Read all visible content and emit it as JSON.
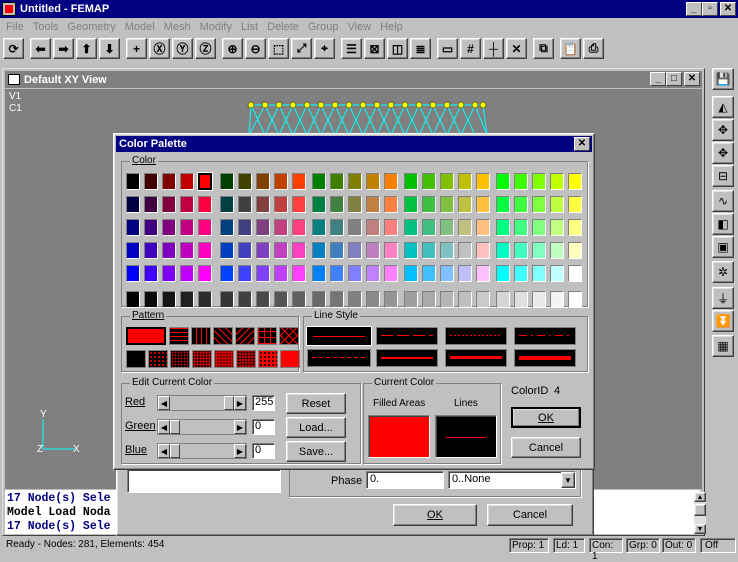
{
  "app": {
    "title": "Untitled - FEMAP"
  },
  "menu": [
    "File",
    "Tools",
    "Geometry",
    "Model",
    "Mesh",
    "Modify",
    "List",
    "Delete",
    "Group",
    "View",
    "Help"
  ],
  "toolbar_icons": [
    "rotate-icon",
    "prev-icon",
    "next-icon",
    "up-icon",
    "down-icon",
    "add-icon",
    "rotate-x-icon",
    "rotate-y-icon",
    "rotate-z-icon",
    "zoom-in-icon",
    "zoom-out-icon",
    "box-zoom-icon",
    "fit-icon",
    "center-icon",
    "list-icon",
    "select-icon",
    "solid-icon",
    "layers-icon",
    "window-icon",
    "grid-icon",
    "plus-icon",
    "cross-icon",
    "copy-icon",
    "paste-icon",
    "print-icon"
  ],
  "view_window": {
    "title": "Default XY View",
    "label_v": "V1",
    "label_c": "C1",
    "axis_y": "Y",
    "axis_z": "Z",
    "axis_x": "X"
  },
  "messages": [
    "17 Node(s) Sele",
    "Model Load Noda",
    "17 Node(s) Sele"
  ],
  "status": {
    "text": "Ready - Nodes: 281,  Elements: 454",
    "cells": [
      "Prop: 1",
      "Ld: 1",
      "Con: 1",
      "Grp: 0",
      "Out: 0",
      "Off"
    ]
  },
  "dialog": {
    "title": "Color Palette",
    "color_group": "Color",
    "pattern_group": "Pattern",
    "line_style_group": "Line Style",
    "edit_group": "Edit Current Color",
    "current_group": "Current Color",
    "red_label": "Red",
    "green_label": "Green",
    "blue_label": "Blue",
    "red_value": "255",
    "green_value": "0",
    "blue_value": "0",
    "reset_button": "Reset",
    "load_button": "Load...",
    "save_button": "Save...",
    "filled_areas": "Filled Areas",
    "lines": "Lines",
    "color_id_label": "ColorID",
    "color_id": "4",
    "ok_button": "OK",
    "cancel_button": "Cancel",
    "current_color": "#ff0000"
  },
  "back_dialog": {
    "phase_label": "Phase",
    "phase_value": "0.",
    "select_value": "0..None",
    "ok_button": "OK",
    "cancel_button": "Cancel"
  },
  "palette": {
    "row_count": 6,
    "blocks": [
      {
        "bases": [
          "#000000",
          "#400000",
          "#800000",
          "#c00000",
          "#ff0000"
        ]
      },
      {
        "bases": [
          "#004000",
          "#404000",
          "#804000",
          "#c04000",
          "#ff4000"
        ]
      },
      {
        "bases": [
          "#008000",
          "#408000",
          "#808000",
          "#c08000",
          "#ff8000"
        ]
      },
      {
        "bases": [
          "#00c000",
          "#40c000",
          "#80c000",
          "#c0c000",
          "#ffc000"
        ]
      },
      {
        "bases": [
          "#00ff00",
          "#40ff00",
          "#80ff00",
          "#c0ff00",
          "#ffff00"
        ]
      }
    ],
    "blue_steps": [
      0,
      64,
      128,
      192,
      255
    ],
    "selected": {
      "block": 0,
      "col": 4,
      "row": 0
    }
  }
}
